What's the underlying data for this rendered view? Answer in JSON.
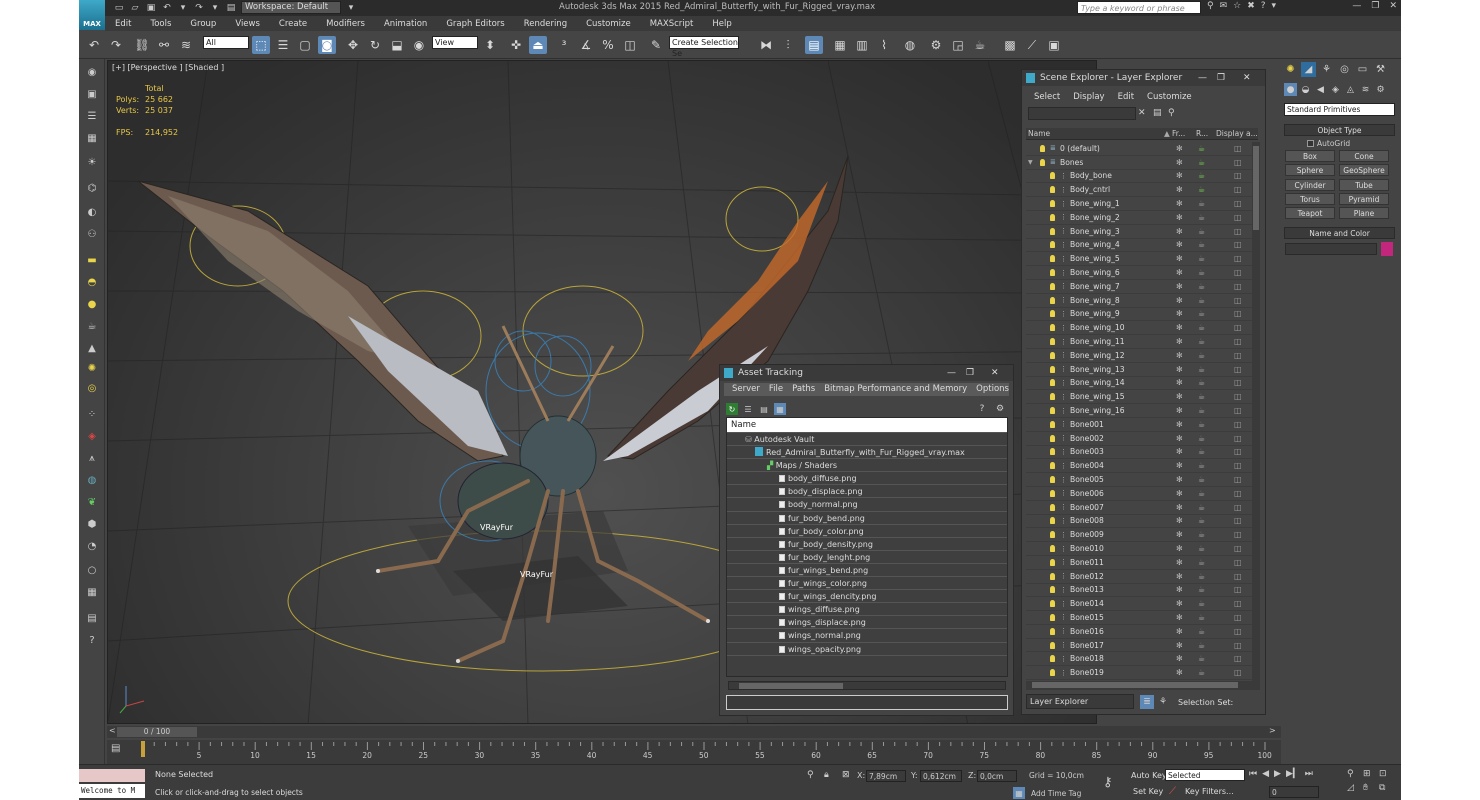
{
  "window": {
    "title": "Autodesk 3ds Max 2015    Red_Admiral_Butterfly_with_Fur_Rigged_vray.max",
    "workspace": "Workspace: Default",
    "search_placeholder": "Type a keyword or phrase",
    "logo": "MAX"
  },
  "menu": [
    "Edit",
    "Tools",
    "Group",
    "Views",
    "Create",
    "Modifiers",
    "Animation",
    "Graph Editors",
    "Rendering",
    "Customize",
    "MAXScript",
    "Help"
  ],
  "toolbar": {
    "filter": "All",
    "ref_coord": "View",
    "selection_set": "Create Selection Se"
  },
  "viewport": {
    "label": "[+] [Perspective ] [Shaded ]",
    "stats_total": "Total",
    "polys_label": "Polys:",
    "polys_value": "25 662",
    "verts_label": "Verts:",
    "verts_value": "25 037",
    "fps_label": "FPS:",
    "fps_value": "214,952",
    "fur_label_1": "VRayFur",
    "fur_label_2": "VRayFur"
  },
  "scene_explorer": {
    "title": "Scene Explorer - Layer Explorer",
    "menu": [
      "Select",
      "Display",
      "Edit",
      "Customize"
    ],
    "columns": [
      "Name",
      "Fr...",
      "R...",
      "Display a..."
    ],
    "rows": [
      {
        "name": "0 (default)",
        "indent": 0
      },
      {
        "name": "Bones",
        "indent": 0
      },
      {
        "name": "Body_bone",
        "indent": 1
      },
      {
        "name": "Body_cntrl",
        "indent": 1
      },
      {
        "name": "Bone_wing_1",
        "indent": 1
      },
      {
        "name": "Bone_wing_2",
        "indent": 1
      },
      {
        "name": "Bone_wing_3",
        "indent": 1
      },
      {
        "name": "Bone_wing_4",
        "indent": 1
      },
      {
        "name": "Bone_wing_5",
        "indent": 1
      },
      {
        "name": "Bone_wing_6",
        "indent": 1
      },
      {
        "name": "Bone_wing_7",
        "indent": 1
      },
      {
        "name": "Bone_wing_8",
        "indent": 1
      },
      {
        "name": "Bone_wing_9",
        "indent": 1
      },
      {
        "name": "Bone_wing_10",
        "indent": 1
      },
      {
        "name": "Bone_wing_11",
        "indent": 1
      },
      {
        "name": "Bone_wing_12",
        "indent": 1
      },
      {
        "name": "Bone_wing_13",
        "indent": 1
      },
      {
        "name": "Bone_wing_14",
        "indent": 1
      },
      {
        "name": "Bone_wing_15",
        "indent": 1
      },
      {
        "name": "Bone_wing_16",
        "indent": 1
      },
      {
        "name": "Bone001",
        "indent": 1
      },
      {
        "name": "Bone002",
        "indent": 1
      },
      {
        "name": "Bone003",
        "indent": 1
      },
      {
        "name": "Bone004",
        "indent": 1
      },
      {
        "name": "Bone005",
        "indent": 1
      },
      {
        "name": "Bone006",
        "indent": 1
      },
      {
        "name": "Bone007",
        "indent": 1
      },
      {
        "name": "Bone008",
        "indent": 1
      },
      {
        "name": "Bone009",
        "indent": 1
      },
      {
        "name": "Bone010",
        "indent": 1
      },
      {
        "name": "Bone011",
        "indent": 1
      },
      {
        "name": "Bone012",
        "indent": 1
      },
      {
        "name": "Bone013",
        "indent": 1
      },
      {
        "name": "Bone014",
        "indent": 1
      },
      {
        "name": "Bone015",
        "indent": 1
      },
      {
        "name": "Bone016",
        "indent": 1
      },
      {
        "name": "Bone017",
        "indent": 1
      },
      {
        "name": "Bone018",
        "indent": 1
      },
      {
        "name": "Bone019",
        "indent": 1
      }
    ],
    "footer_explorer": "Layer Explorer",
    "footer_selection": "Selection Set:"
  },
  "asset_tracking": {
    "title": "Asset Tracking",
    "menu": [
      "Server",
      "File",
      "Paths",
      "Bitmap Performance and Memory",
      "Options"
    ],
    "column": "Name",
    "vault": "Autodesk Vault",
    "file": "Red_Admiral_Butterfly_with_Fur_Rigged_vray.max",
    "group": "Maps / Shaders",
    "maps": [
      "body_diffuse.png",
      "body_displace.png",
      "body_normal.png",
      "fur_body_bend.png",
      "fur_body_color.png",
      "fur_body_density.png",
      "fur_body_lenght.png",
      "fur_wings_bend.png",
      "fur_wings_color.png",
      "fur_wings_dencity.png",
      "wings_diffuse.png",
      "wings_displace.png",
      "wings_normal.png",
      "wings_opacity.png"
    ]
  },
  "command_panel": {
    "category": "Standard Primitives",
    "object_type": "Object Type",
    "autogrid": "AutoGrid",
    "buttons": [
      "Box",
      "Cone",
      "Sphere",
      "GeoSphere",
      "Cylinder",
      "Tube",
      "Torus",
      "Pyramid",
      "Teapot",
      "Plane"
    ],
    "name_and_color": "Name and Color",
    "swatch_color": "#c2277d"
  },
  "timeline": {
    "frame": "0 / 100",
    "ticks": [
      "5",
      "10",
      "15",
      "20",
      "25",
      "30",
      "35",
      "40",
      "45",
      "50",
      "55",
      "60",
      "65",
      "70",
      "75",
      "80",
      "85",
      "90",
      "95",
      "100"
    ]
  },
  "status": {
    "maxscript": "Welcome to M",
    "selection": "None Selected",
    "prompt": "Click or click-and-drag to select objects",
    "x_label": "X:",
    "x_value": "7,89cm",
    "y_label": "Y:",
    "y_value": "0,612cm",
    "z_label": "Z:",
    "z_value": "0,0cm",
    "grid": "Grid = 10,0cm",
    "add_time_tag": "Add Time Tag",
    "auto_key": "Auto Key",
    "selected": "Selected",
    "set_key": "Set Key",
    "key_filters": "Key Filters...",
    "current_frame": "0"
  }
}
